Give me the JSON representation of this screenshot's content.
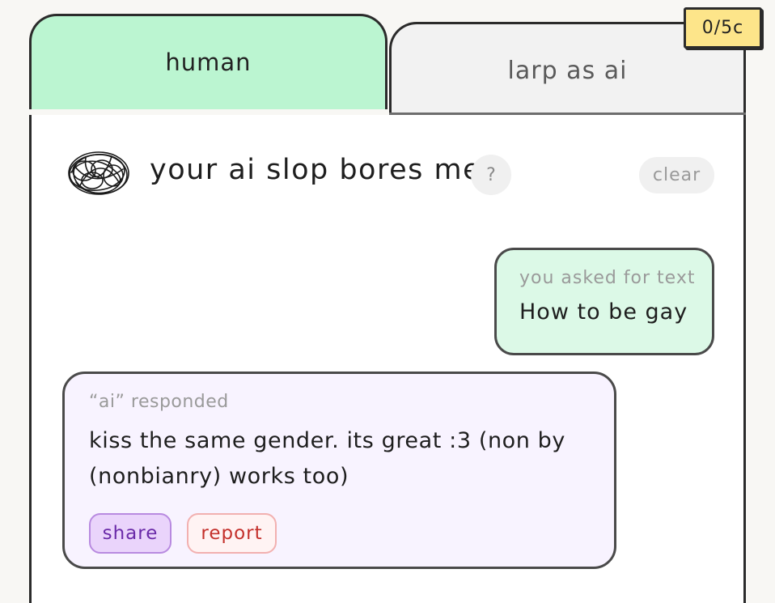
{
  "tabs": {
    "human": "human",
    "ai": "larp as ai"
  },
  "counter": "0/5c",
  "header": {
    "title": "your ai slop bores me",
    "help": "?",
    "clear": "clear"
  },
  "user_message": {
    "meta": "you asked for text",
    "text": "How to be gay"
  },
  "ai_message": {
    "meta": "“ai” responded",
    "text": "kiss the same gender. its great :3 (non by (nonbianry) works too)",
    "share": "share",
    "report": "report"
  },
  "colors": {
    "human_tab": "#bbf5d1",
    "ai_tab": "#f2f2f2",
    "counter_bg": "#fde58a",
    "user_bubble": "#dcf9e7",
    "ai_bubble": "#f8f3ff",
    "share": "#ead4fb",
    "report_text": "#c4302b"
  },
  "icons": {
    "logo": "scribble-icon"
  }
}
